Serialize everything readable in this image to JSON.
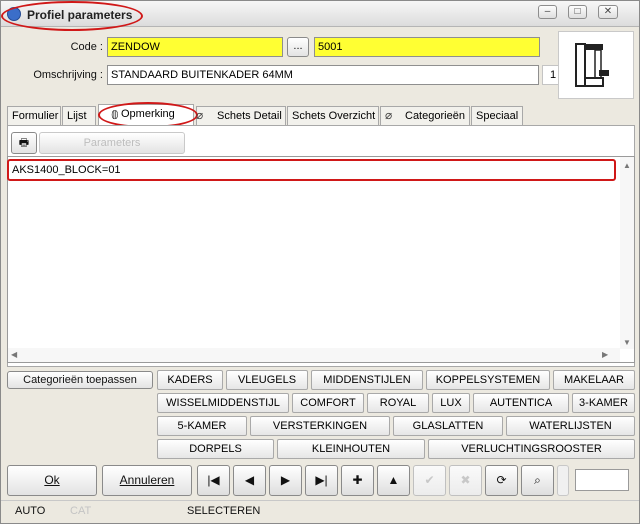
{
  "window": {
    "title": "Profiel parameters",
    "buttons": [
      "–",
      "□",
      "✕"
    ]
  },
  "form": {
    "code_label": "Code :",
    "code_value": "ZENDOW",
    "browse_label": "...",
    "number_value": "5001",
    "omschrijving_label": "Omschrijving :",
    "omschrijving_value": "STANDAARD BUITENKADER 64MM",
    "count_value": "1"
  },
  "tabs": [
    "Formulier",
    "Lijst",
    "Opmerking",
    "Schets Detail",
    "Schets Overzicht",
    "Categorieën",
    "Speciaal"
  ],
  "toolbar": {
    "parameters_label": "Parameters"
  },
  "memo": {
    "text": "AKS1400_BLOCK=01"
  },
  "categories": {
    "apply_label": "Categorieën toepassen",
    "row1": [
      "KADERS",
      "VLEUGELS",
      "MIDDENSTIJLEN",
      "KOPPELSYSTEMEN",
      "MAKELAAR"
    ],
    "row2": [
      "WISSELMIDDENSTIJL",
      "COMFORT",
      "ROYAL",
      "LUX",
      "AUTENTICA",
      "3-KAMER"
    ],
    "row3": [
      "5-KAMER",
      "VERSTERKINGEN",
      "GLASLATTEN",
      "WATERLIJSTEN"
    ],
    "row4": [
      "DORPELS",
      "KLEINHOUTEN",
      "VERLUCHTINGSROOSTER"
    ]
  },
  "bottom": {
    "ok_label": "Ok",
    "cancel_label": "Annuleren"
  },
  "status": {
    "mode": "AUTO",
    "cat": "CAT",
    "action": "SELECTEREN"
  }
}
